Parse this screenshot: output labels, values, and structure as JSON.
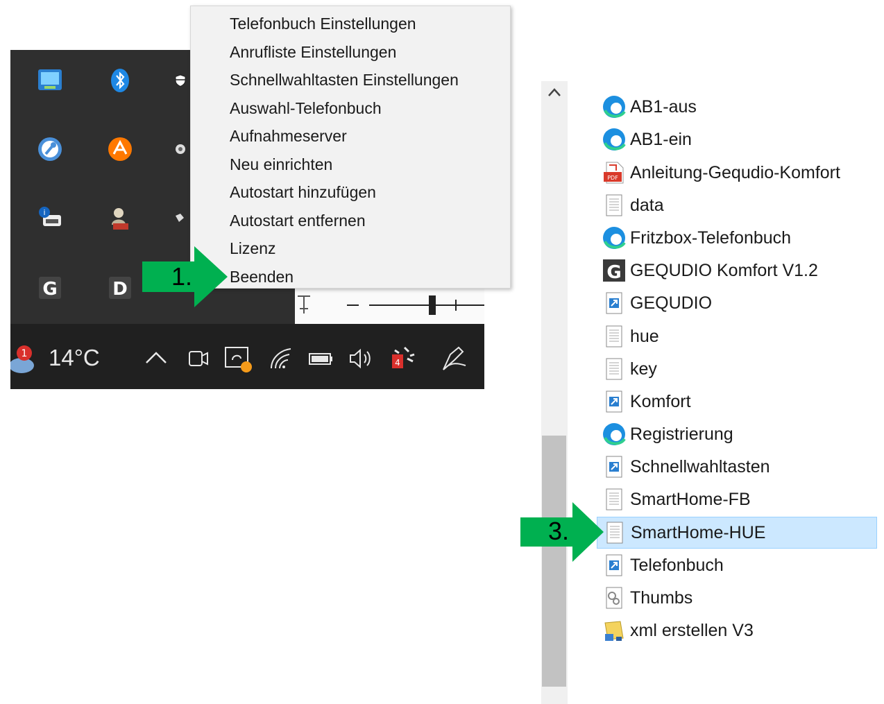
{
  "tray": {
    "temperature": "14°C",
    "weather_badge": "1",
    "calendar_badge": "4"
  },
  "context_menu": {
    "items": [
      "Telefonbuch Einstellungen",
      "Anrufliste Einstellungen",
      "Schnellwahltasten Einstellungen",
      "Auswahl-Telefonbuch",
      "Aufnahmeserver",
      "Neu einrichten",
      "Autostart hinzufügen",
      "Autostart entfernen",
      "Lizenz",
      "Beenden"
    ]
  },
  "annotations": {
    "step1": "1.",
    "step3": "3."
  },
  "explorer": {
    "files": [
      {
        "name": "AB1-aus",
        "icon": "edge-icon"
      },
      {
        "name": "AB1-ein",
        "icon": "edge-icon"
      },
      {
        "name": "Anleitung-Gequdio-Komfort",
        "icon": "pdf-icon"
      },
      {
        "name": "data",
        "icon": "text-file-icon"
      },
      {
        "name": "Fritzbox-Telefonbuch",
        "icon": "edge-icon"
      },
      {
        "name": "GEQUDIO Komfort V1.2",
        "icon": "gequdio-app-icon"
      },
      {
        "name": "GEQUDIO",
        "icon": "shortcut-icon"
      },
      {
        "name": "hue",
        "icon": "text-file-icon"
      },
      {
        "name": "key",
        "icon": "text-file-icon"
      },
      {
        "name": "Komfort",
        "icon": "shortcut-icon"
      },
      {
        "name": "Registrierung",
        "icon": "edge-icon"
      },
      {
        "name": "Schnellwahltasten",
        "icon": "shortcut-icon"
      },
      {
        "name": "SmartHome-FB",
        "icon": "text-file-icon"
      },
      {
        "name": "SmartHome-HUE",
        "icon": "text-file-icon",
        "selected": true
      },
      {
        "name": "Telefonbuch",
        "icon": "shortcut-icon"
      },
      {
        "name": "Thumbs",
        "icon": "system-file-icon"
      },
      {
        "name": "xml erstellen V3",
        "icon": "script-icon"
      }
    ],
    "selected_index": 13
  },
  "colors": {
    "arrow": "#00b050",
    "selection": "#cce8ff",
    "taskbar": "#202020",
    "tray_panel": "#2f2f2f"
  }
}
